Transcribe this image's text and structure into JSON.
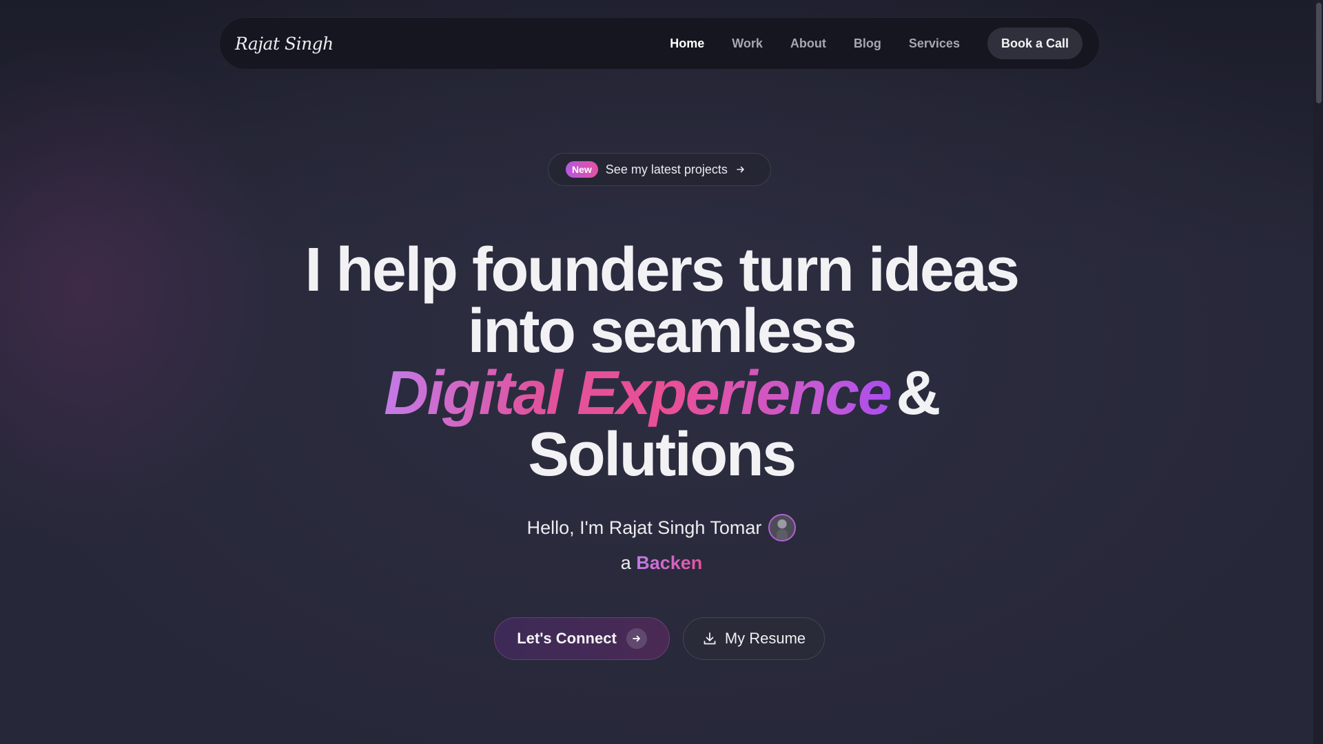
{
  "nav": {
    "logo": "Rajat Singh",
    "links": [
      "Home",
      "Work",
      "About",
      "Blog",
      "Services"
    ],
    "active": "Home",
    "cta": "Book a Call"
  },
  "announcement": {
    "tag": "New",
    "text": "See my latest projects",
    "icon": "arrow-right-icon"
  },
  "hero": {
    "line1": "I help founders turn ideas",
    "line2": "into seamless",
    "highlight": "Digital Experience",
    "amp": "&",
    "line4": "Solutions",
    "intro": "Hello, I'm Rajat Singh Tomar",
    "role_prefix": "a",
    "role_word": "Backen"
  },
  "buttons": {
    "connect": "Let's Connect",
    "resume": "My Resume"
  },
  "colors": {
    "accent_purple": "#c37be9",
    "accent_pink": "#e3529f",
    "background": "#252636"
  }
}
